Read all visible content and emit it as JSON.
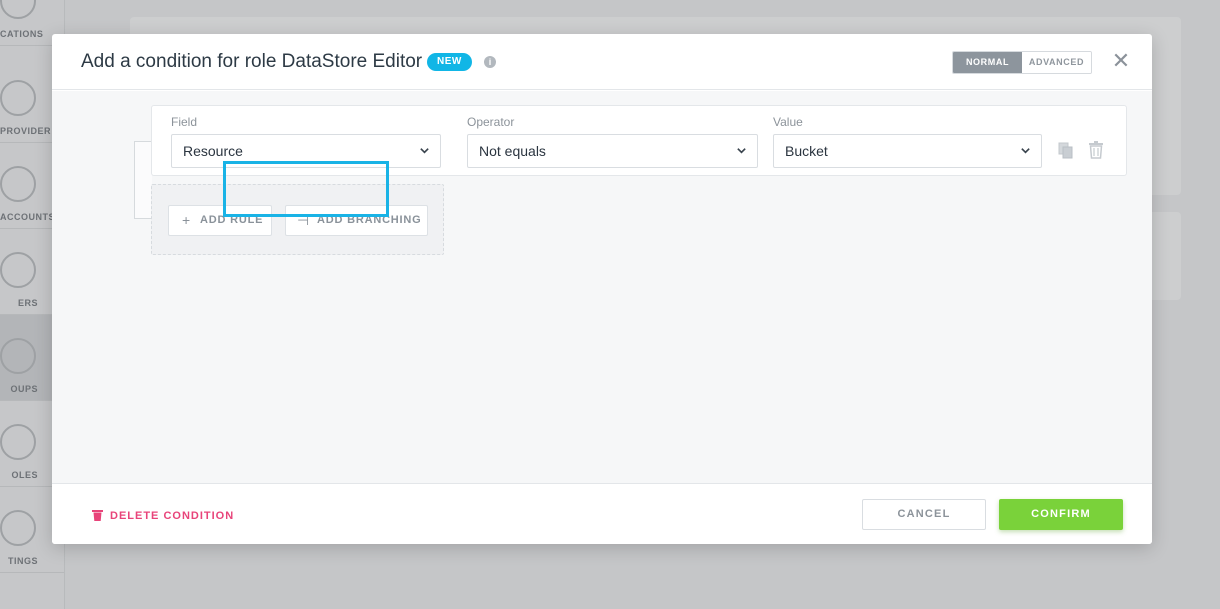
{
  "background": {
    "nav": [
      {
        "label": "CATIONS",
        "active": false
      },
      {
        "label": "PROVIDER",
        "active": false
      },
      {
        "label": "ACCOUNTS",
        "active": false
      },
      {
        "label": "ERS",
        "active": false
      },
      {
        "label": "OUPS",
        "active": true
      },
      {
        "label": "OLES",
        "active": false
      },
      {
        "label": "TINGS",
        "active": false
      }
    ]
  },
  "modal": {
    "title": "Add a condition for role DataStore Editor",
    "badge": "NEW",
    "info_glyph": "i",
    "mode": {
      "normal": "NORMAL",
      "advanced": "ADVANCED",
      "selected": "NORMAL"
    },
    "close_glyph": "✕",
    "rule": {
      "field": {
        "label": "Field",
        "value": "Resource"
      },
      "operator": {
        "label": "Operator",
        "value": "Not equals"
      },
      "value": {
        "label": "Value",
        "value": "Bucket"
      }
    },
    "actions": {
      "add_rule": "ADD RULE",
      "add_rule_glyph": "+",
      "add_branching": "ADD BRANCHING",
      "add_branching_glyph": "⊣"
    },
    "footer": {
      "delete": "DELETE CONDITION",
      "cancel": "CANCEL",
      "confirm": "CONFIRM"
    }
  },
  "colors": {
    "accent": "#11b6e6",
    "confirm": "#7ad23a",
    "danger": "#e8447a",
    "highlight": "#19b3e6"
  }
}
